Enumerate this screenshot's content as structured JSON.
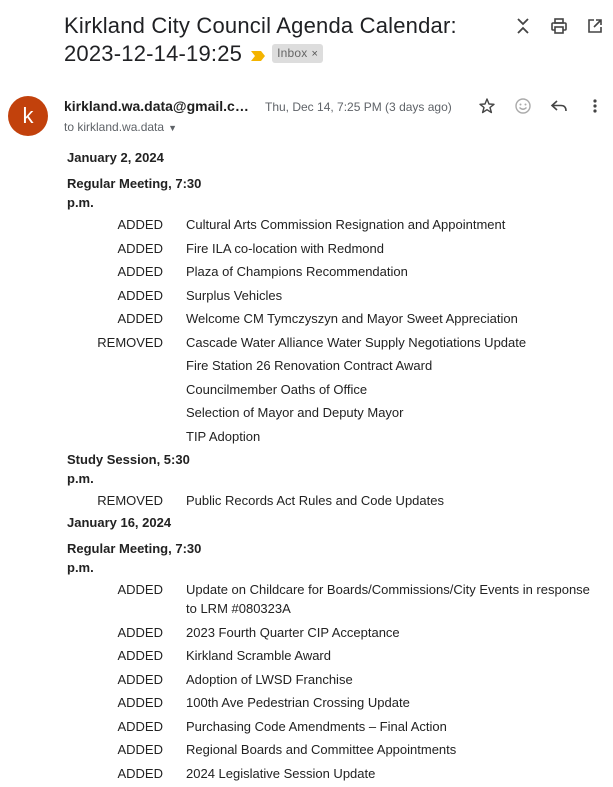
{
  "subject": {
    "title": "Kirkland City Council Agenda Calendar: 2023-12-14-19:25",
    "label": "Inbox"
  },
  "message": {
    "avatar_letter": "k",
    "sender": "kirkland.wa.data@gmail.c…",
    "to": "to kirkland.wa.data",
    "date": "Thu, Dec 14, 7:25 PM (3 days ago)"
  },
  "icons": {
    "expand": "unfold-icon",
    "print": "print-icon",
    "popout": "open-in-new-icon",
    "star": "star-icon",
    "emoji": "emoji-icon",
    "reply": "reply-icon",
    "more": "more-vert-icon"
  },
  "agenda": {
    "jan2_date": "January 2, 2024",
    "jan2_regular": "Regular Meeting, 7:30 p.m.",
    "jan2_regular_rows": [
      {
        "status": "ADDED",
        "item": "Cultural Arts Commission Resignation and Appointment"
      },
      {
        "status": "ADDED",
        "item": "Fire ILA co-location with Redmond"
      },
      {
        "status": "ADDED",
        "item": "Plaza of Champions Recommendation"
      },
      {
        "status": "ADDED",
        "item": "Surplus Vehicles"
      },
      {
        "status": "ADDED",
        "item": "Welcome CM Tymczyszyn and Mayor Sweet Appreciation"
      },
      {
        "status": "REMOVED",
        "item": "Cascade Water Alliance Water Supply Negotiations Update"
      },
      {
        "status": "",
        "item": "Fire Station 26 Renovation Contract Award"
      },
      {
        "status": "",
        "item": "Councilmember Oaths of Office"
      },
      {
        "status": "",
        "item": "Selection of Mayor and Deputy Mayor"
      },
      {
        "status": "",
        "item": "TIP Adoption"
      }
    ],
    "jan2_study": "Study Session, 5:30 p.m.",
    "jan2_study_rows": [
      {
        "status": "REMOVED",
        "item": "Public Records Act Rules and Code Updates"
      }
    ],
    "jan16_date": "January 16, 2024",
    "jan16_regular": "Regular Meeting, 7:30 p.m.",
    "jan16_regular_rows": [
      {
        "status": "ADDED",
        "item": "Update on Childcare for Boards/Commissions/City Events in response to LRM #080323A"
      },
      {
        "status": "ADDED",
        "item": "2023 Fourth Quarter CIP Acceptance"
      },
      {
        "status": "ADDED",
        "item": "Kirkland Scramble Award"
      },
      {
        "status": "ADDED",
        "item": "Adoption of LWSD Franchise"
      },
      {
        "status": "ADDED",
        "item": "100th Ave Pedestrian Crossing Update"
      },
      {
        "status": "ADDED",
        "item": "Purchasing Code Amendments – Final Action"
      },
      {
        "status": "ADDED",
        "item": "Regional Boards and Committee Appointments"
      },
      {
        "status": "ADDED",
        "item": "2024 Legislative Session Update"
      }
    ]
  }
}
